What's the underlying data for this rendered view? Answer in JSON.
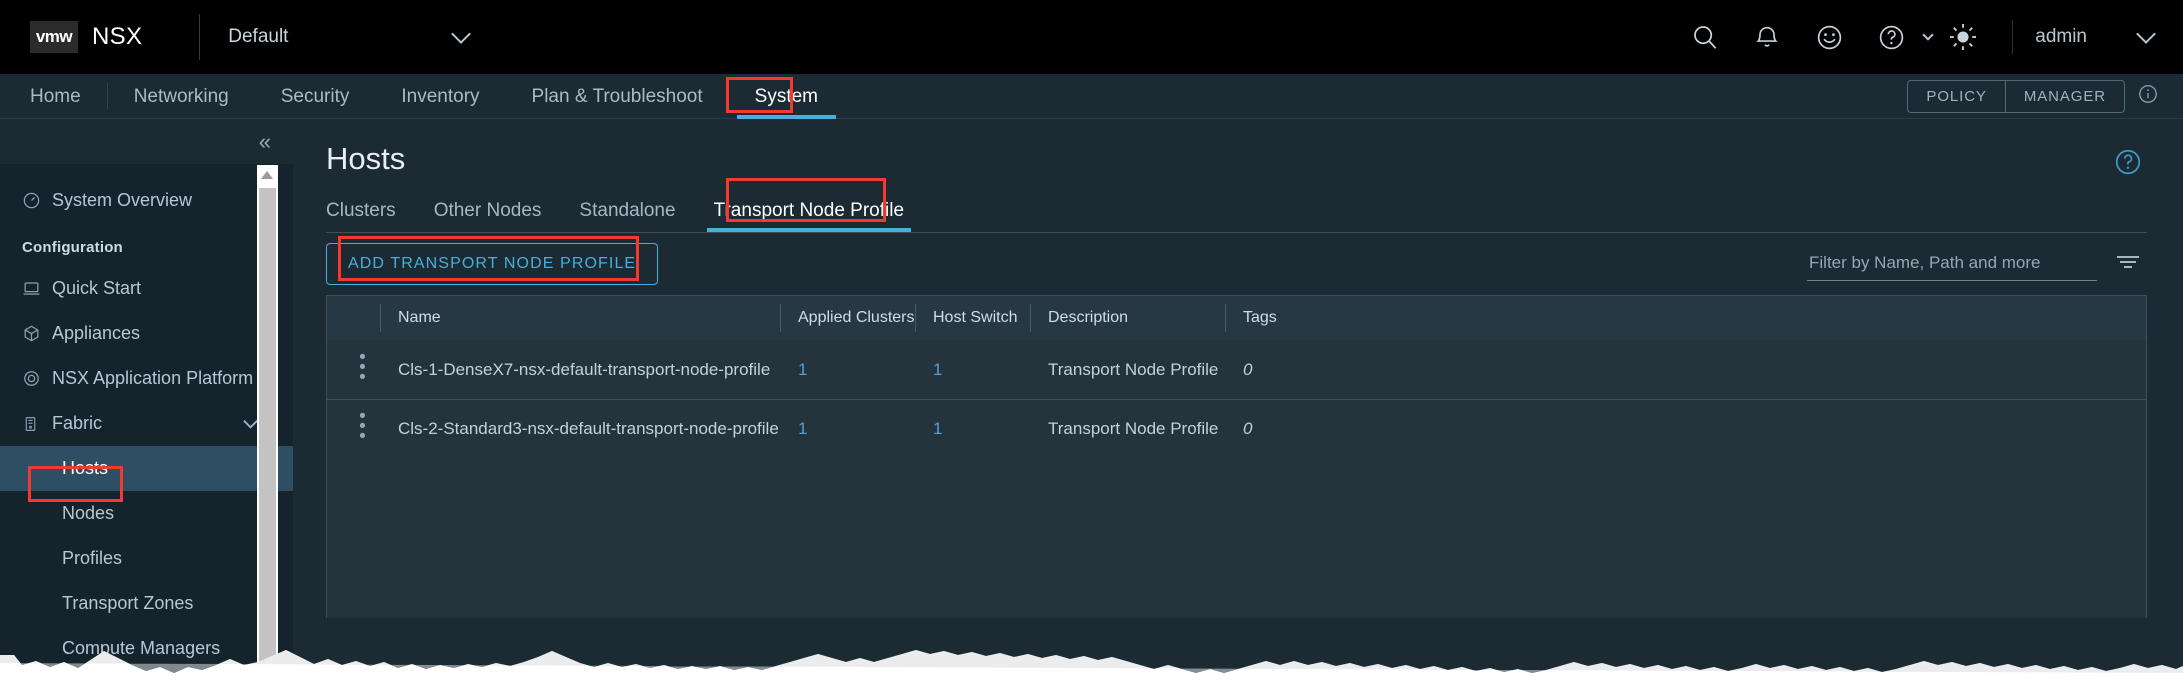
{
  "topbar": {
    "logo_text": "vmw",
    "product": "NSX",
    "tenant": "Default",
    "icons": [
      "search-icon",
      "bell-icon",
      "smiley-icon",
      "help-icon",
      "brightness-icon"
    ],
    "username": "admin"
  },
  "nav": {
    "items": [
      {
        "label": "Home",
        "active": false
      },
      {
        "label": "Networking",
        "active": false
      },
      {
        "label": "Security",
        "active": false
      },
      {
        "label": "Inventory",
        "active": false
      },
      {
        "label": "Plan & Troubleshoot",
        "active": false
      },
      {
        "label": "System",
        "active": true
      }
    ],
    "mode_policy": "POLICY",
    "mode_manager": "MANAGER"
  },
  "sidebar": {
    "overview": "System Overview",
    "section_label": "Configuration",
    "items": [
      {
        "label": "Quick Start"
      },
      {
        "label": "Appliances"
      },
      {
        "label": "NSX Application Platform"
      },
      {
        "label": "Fabric"
      }
    ],
    "sub_items": [
      {
        "label": "Hosts",
        "selected": true
      },
      {
        "label": "Nodes",
        "selected": false
      },
      {
        "label": "Profiles",
        "selected": false
      },
      {
        "label": "Transport Zones",
        "selected": false
      },
      {
        "label": "Compute Managers",
        "selected": false
      }
    ]
  },
  "main": {
    "title": "Hosts",
    "tabs": [
      {
        "label": "Clusters",
        "active": false
      },
      {
        "label": "Other Nodes",
        "active": false
      },
      {
        "label": "Standalone",
        "active": false
      },
      {
        "label": "Transport Node Profile",
        "active": true
      }
    ],
    "add_button": "ADD TRANSPORT NODE PROFILE",
    "filter_placeholder": "Filter by Name, Path and more",
    "columns": [
      "Name",
      "Applied Clusters",
      "Host Switch",
      "Description",
      "Tags"
    ],
    "rows": [
      {
        "name": "Cls-1-DenseX7-nsx-default-transport-node-profile",
        "applied_clusters": "1",
        "host_switch": "1",
        "description": "Transport Node Profile",
        "tags": "0"
      },
      {
        "name": "Cls-2-Standard3-nsx-default-transport-node-profile",
        "applied_clusters": "1",
        "host_switch": "1",
        "description": "Transport Node Profile",
        "tags": "0"
      }
    ]
  },
  "colors": {
    "accent": "#49afd9",
    "highlight_box": "#f4392e",
    "link": "#4ea0d8",
    "topbar_bg": "#000000",
    "nav_bg": "#1b2a33",
    "sidebar_bg": "#15242c",
    "selected_bg": "#2e4f63",
    "table_header_bg": "#263844",
    "table_row_bg": "#24333c"
  }
}
